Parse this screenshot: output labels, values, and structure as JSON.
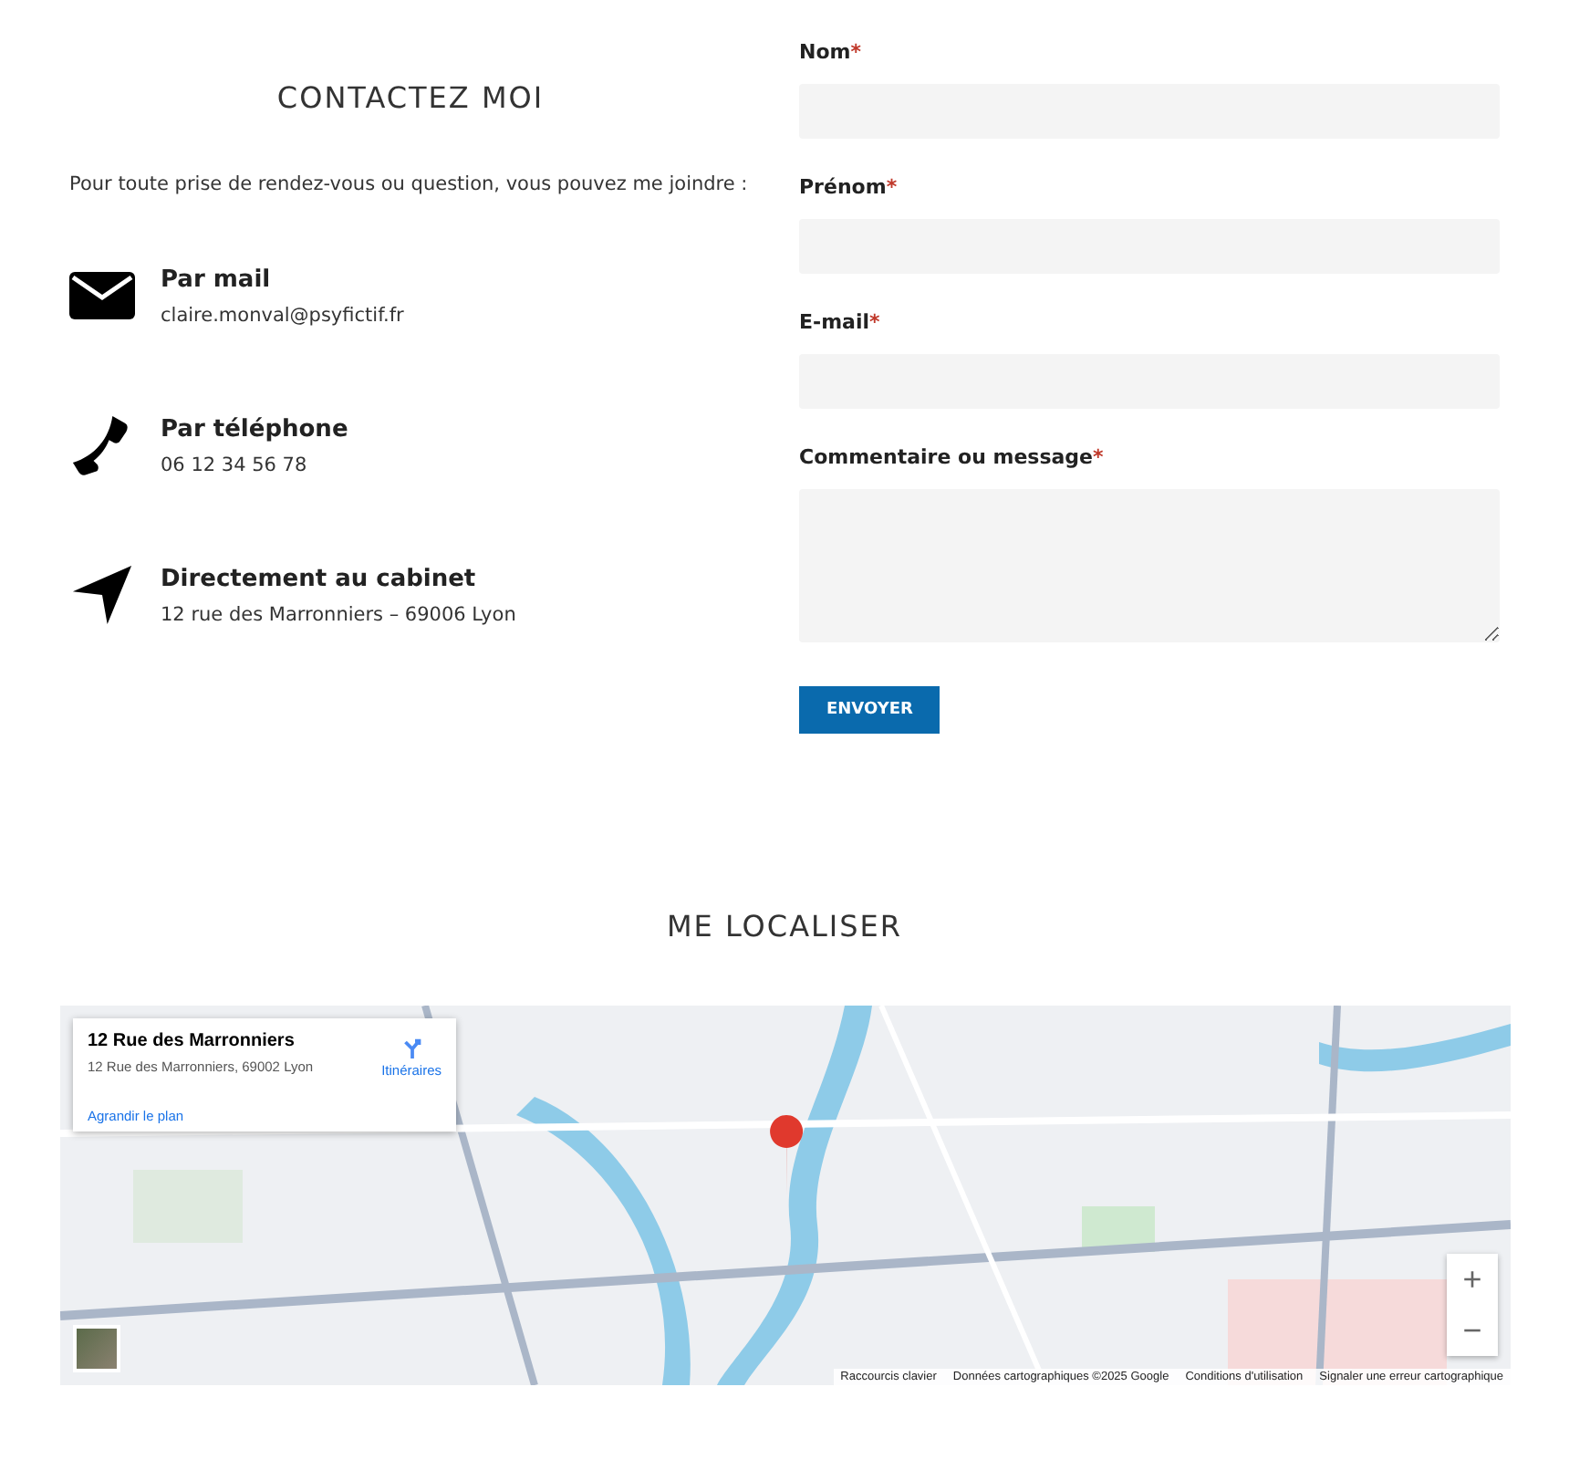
{
  "contact": {
    "title": "CONTACTEZ MOI",
    "intro": "Pour toute prise de rendez-vous ou question, vous pouvez me joindre :",
    "items": [
      {
        "kind": "mail",
        "title": "Par mail",
        "detail": "claire.monval@psyfictif.fr"
      },
      {
        "kind": "phone",
        "title": "Par téléphone",
        "detail": "06 12 34 56 78"
      },
      {
        "kind": "location",
        "title": "Directement au cabinet",
        "detail": "12 rue des Marronniers – 69006 Lyon"
      }
    ]
  },
  "form": {
    "fields": [
      {
        "kind": "input",
        "label": "Nom",
        "required": true
      },
      {
        "kind": "input",
        "label": "Prénom",
        "required": true
      },
      {
        "kind": "input",
        "label": "E-mail",
        "required": true
      },
      {
        "kind": "textarea",
        "label": "Commentaire ou message",
        "required": true
      }
    ],
    "required_mark": "*",
    "submit": "ENVOYER"
  },
  "map_section": {
    "title": "ME LOCALISER",
    "map": {
      "kind": "picture",
      "card": {
        "title": "12 Rue des Marronniers",
        "address": "12 Rue des Marronniers, 69002 Lyon",
        "directions": "Itinéraires",
        "enlarge": "Agrandir le plan"
      },
      "zoom_in": "+",
      "zoom_out": "−",
      "footer": [
        "Raccourcis clavier",
        "Données cartographiques ©2025 Google",
        "Conditions d'utilisation",
        "Signaler une erreur cartographique"
      ]
    }
  }
}
